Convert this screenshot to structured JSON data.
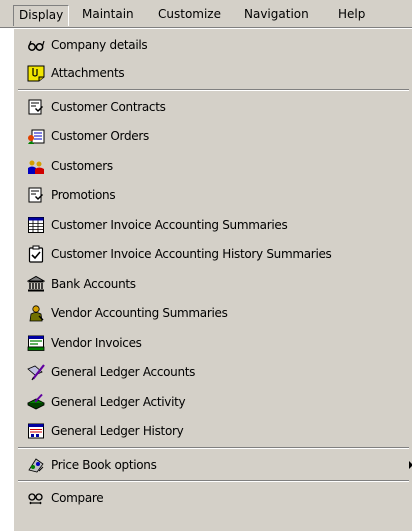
{
  "menubar": {
    "items": [
      {
        "label": "Display"
      },
      {
        "label": "Maintain"
      },
      {
        "label": "Customize"
      },
      {
        "label": "Navigation"
      },
      {
        "label": "Help"
      }
    ]
  },
  "menu": {
    "items": [
      {
        "label": "Company details",
        "icon": "glasses-icon"
      },
      {
        "label": "Attachments",
        "icon": "attachment-icon"
      },
      {
        "label": "Customer Contracts",
        "icon": "contract-document-icon"
      },
      {
        "label": "Customer Orders",
        "icon": "orders-icon"
      },
      {
        "label": "Customers",
        "icon": "people-icon"
      },
      {
        "label": "Promotions",
        "icon": "promotion-document-icon"
      },
      {
        "label": "Customer Invoice Accounting Summaries",
        "icon": "ledger-grid-icon"
      },
      {
        "label": "Customer Invoice Accounting History Summaries",
        "icon": "clipboard-check-icon"
      },
      {
        "label": "Bank Accounts",
        "icon": "bank-icon"
      },
      {
        "label": "Vendor Accounting Summaries",
        "icon": "vendor-person-icon"
      },
      {
        "label": "Vendor Invoices",
        "icon": "vendor-invoice-icon"
      },
      {
        "label": "General Ledger Accounts",
        "icon": "pen-ledger-icon"
      },
      {
        "label": "General Ledger Activity",
        "icon": "ledger-activity-icon"
      },
      {
        "label": "General Ledger History",
        "icon": "ledger-history-icon"
      },
      {
        "label": "Price Book options",
        "icon": "price-book-icon"
      },
      {
        "label": "Compare",
        "icon": "compare-icon"
      }
    ]
  },
  "colors": {
    "menu_background": "#d4d0c8",
    "shadow": "#808080",
    "highlight": "#ffffff"
  }
}
